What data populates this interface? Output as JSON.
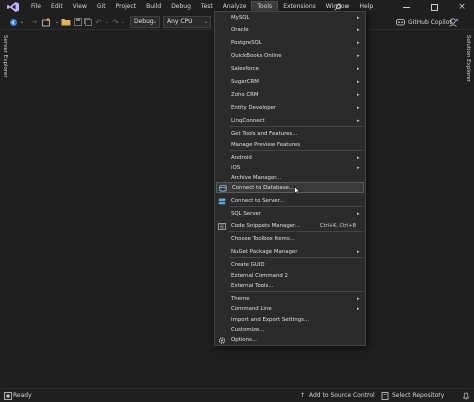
{
  "menubar": {
    "items": [
      "File",
      "Edit",
      "View",
      "Git",
      "Project",
      "Build",
      "Debug",
      "Test",
      "Analyze",
      "Tools",
      "Extensions",
      "Window",
      "Help"
    ],
    "active": "Tools"
  },
  "toolbar": {
    "config_combo": "Debug",
    "platform_combo": "Any CPU",
    "copilot_label": "GitHub Copilot"
  },
  "side_panels": {
    "left": "Server Explorer",
    "right": "Solution Explorer"
  },
  "statusbar": {
    "status": "Ready",
    "source_control": "Add to Source Control",
    "repository": "Select Repository"
  },
  "tools_menu": {
    "items": [
      {
        "label": "MySQL",
        "submenu": true
      },
      {
        "label": "Oracle",
        "submenu": true
      },
      {
        "label": "PostgreSQL",
        "submenu": true
      },
      {
        "label": "QuickBooks Online",
        "submenu": true
      },
      {
        "label": "Salesforce",
        "submenu": true
      },
      {
        "label": "SugarCRM",
        "submenu": true
      },
      {
        "label": "Zoho CRM",
        "submenu": true
      },
      {
        "label": "Entity Developer",
        "submenu": true
      },
      {
        "label": "LinqConnect",
        "submenu": true
      },
      {
        "label": "Get Tools and Features..."
      },
      {
        "label": "Manage Preview Features"
      },
      {
        "label": "Android",
        "submenu": true
      },
      {
        "label": "iOS",
        "submenu": true
      },
      {
        "label": "Archive Manager..."
      },
      {
        "label": "Connect to Database...",
        "icon": "connect-database-icon",
        "highlighted": true
      },
      {
        "label": "Connect to Server...",
        "icon": "connect-server-icon"
      },
      {
        "label": "SQL Server",
        "submenu": true
      },
      {
        "label": "Code Snippets Manager...",
        "shortcut": "Ctrl+K, Ctrl+B",
        "icon": "code-snippets-icon"
      },
      {
        "label": "Choose Toolbox Items..."
      },
      {
        "label": "NuGet Package Manager",
        "submenu": true
      },
      {
        "label": "Create GUID"
      },
      {
        "label": "External Command 2"
      },
      {
        "label": "External Tools..."
      },
      {
        "label": "Theme",
        "submenu": true
      },
      {
        "label": "Command Line",
        "submenu": true
      },
      {
        "label": "Import and Export Settings..."
      },
      {
        "label": "Customize..."
      },
      {
        "label": "Options...",
        "icon": "gear-icon"
      }
    ]
  },
  "colors": {
    "accent_purple": "#8661c5",
    "menu_bg": "#2b2b2b",
    "highlight_bg": "#3a3a3a"
  }
}
